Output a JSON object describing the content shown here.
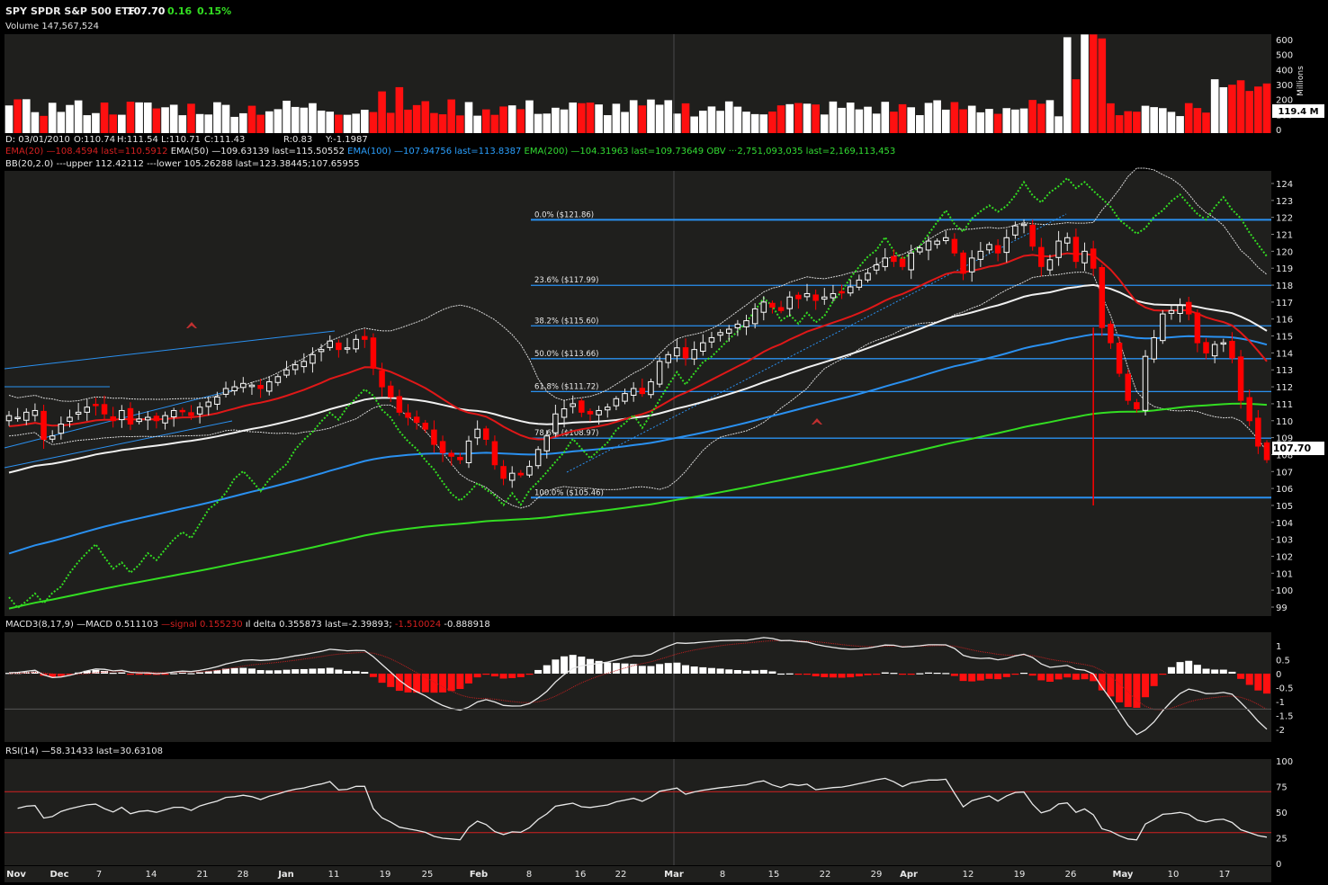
{
  "header": {
    "symbol": "SPY",
    "name": "SPDR S&P 500 ETF",
    "price": "107.70",
    "change": "0.16",
    "change_pct": "0.15%",
    "volume_label": "Volume 147,567,524"
  },
  "info_line": {
    "date": "D: 03/01/2010",
    "open": "O:110.74",
    "high": "H:111.54",
    "low": "L:110.71",
    "close": "C:111.43",
    "r": "R:0.83",
    "y": "Y:-1.1987"
  },
  "legend_line1": [
    {
      "text": "EMA(20) —108.4594 last=110.5912",
      "color": "#d42020"
    },
    {
      "text": "EMA(50) —109.63139 last=115.50552",
      "color": "#e8e8e8"
    },
    {
      "text": "EMA(100) —107.94756 last=113.8387",
      "color": "#2aa0ff"
    },
    {
      "text": "EMA(200) —104.31963 last=109.73649",
      "color": "#33dd33"
    },
    {
      "text": "OBV ···2,751,093,035 last=2,169,113,453",
      "color": "#33dd33"
    }
  ],
  "legend_bb": "BB(20,2.0) ---upper 112.42112 ---lower 105.26288 last=123.38445;107.65955",
  "macd_legend": [
    {
      "text": "MACD3(8,17,9) —MACD 0.511103",
      "color": "#e8e8e8"
    },
    {
      "text": "—signal 0.155230",
      "color": "#d42020"
    },
    {
      "text": "ıl delta 0.355873 last=-2.39893;",
      "color": "#e8e8e8"
    },
    {
      "text": "-1.510024",
      "color": "#d42020"
    },
    {
      "text": "-0.888918",
      "color": "#e8e8e8"
    }
  ],
  "rsi_legend": "RSI(14) —58.31433 last=30.63108",
  "volume_axis": {
    "ticks": [
      "600",
      "500",
      "400",
      "300",
      "200",
      "100",
      "0"
    ],
    "unit": "Millions",
    "last": "119.4 M"
  },
  "last_price_tag": "107.70",
  "colors": {
    "up": "#ffffff",
    "down": "#ff0000",
    "ema20": "#e01818",
    "ema50": "#f0f0f0",
    "ema100": "#2a90f0",
    "ema200": "#33dd22",
    "obv": "#33dd22",
    "fib": "#2a90f0",
    "bg": "#1f1f1d"
  },
  "x_axis": [
    {
      "label": "Nov",
      "bold": true
    },
    {
      "label": "Dec",
      "bold": true
    },
    {
      "label": "7",
      "bold": false
    },
    {
      "label": "14",
      "bold": false
    },
    {
      "label": "21",
      "bold": false
    },
    {
      "label": "28",
      "bold": false
    },
    {
      "label": "Jan",
      "bold": true
    },
    {
      "label": "11",
      "bold": false
    },
    {
      "label": "19",
      "bold": false
    },
    {
      "label": "25",
      "bold": false
    },
    {
      "label": "Feb",
      "bold": true
    },
    {
      "label": "8",
      "bold": false
    },
    {
      "label": "16",
      "bold": false
    },
    {
      "label": "22",
      "bold": false
    },
    {
      "label": "Mar",
      "bold": true
    },
    {
      "label": "8",
      "bold": false
    },
    {
      "label": "15",
      "bold": false
    },
    {
      "label": "22",
      "bold": false
    },
    {
      "label": "29",
      "bold": false
    },
    {
      "label": "Apr",
      "bold": true
    },
    {
      "label": "12",
      "bold": false
    },
    {
      "label": "19",
      "bold": false
    },
    {
      "label": "26",
      "bold": false
    },
    {
      "label": "May",
      "bold": true
    },
    {
      "label": "10",
      "bold": false
    },
    {
      "label": "17",
      "bold": false
    }
  ],
  "chart_data": {
    "type": "candlestick",
    "title": "SPY SPDR S&P 500 ETF",
    "price_axis": {
      "min": 99,
      "max": 124,
      "ticks": [
        99,
        100,
        101,
        102,
        103,
        104,
        105,
        106,
        107,
        108,
        109,
        110,
        111,
        112,
        113,
        114,
        115,
        116,
        117,
        118,
        119,
        120,
        121,
        122,
        123,
        124
      ]
    },
    "fibonacci": [
      {
        "label": "0.0%",
        "price": 121.86,
        "text": "($121.86)"
      },
      {
        "label": "23.6%",
        "price": 117.99,
        "text": "($117.99)"
      },
      {
        "label": "38.2%",
        "price": 115.6,
        "text": "($115.60)"
      },
      {
        "label": "50.0%",
        "price": 113.66,
        "text": "($113.66)"
      },
      {
        "label": "61.8%",
        "price": 111.72,
        "text": "($111.72)"
      },
      {
        "label": "78.6%",
        "price": 108.97,
        "text": "($108.97)"
      },
      {
        "label": "100.0%",
        "price": 105.46,
        "text": "($105.46)"
      }
    ],
    "close": [
      110.3,
      110.2,
      110.5,
      110.6,
      108.9,
      109.1,
      109.8,
      110.2,
      110.5,
      110.8,
      110.9,
      110.4,
      110.0,
      110.6,
      109.8,
      110.1,
      110.2,
      110.0,
      110.3,
      110.6,
      110.6,
      110.3,
      110.8,
      111.1,
      111.4,
      111.9,
      112.0,
      112.2,
      112.1,
      111.9,
      112.3,
      112.6,
      113.0,
      113.3,
      113.5,
      113.9,
      114.2,
      114.7,
      114.2,
      114.3,
      114.8,
      114.8,
      113.1,
      112.0,
      111.4,
      110.5,
      110.2,
      109.9,
      109.5,
      108.6,
      108.1,
      107.9,
      107.7,
      108.8,
      109.5,
      108.9,
      107.4,
      106.6,
      106.9,
      106.8,
      107.3,
      108.3,
      109.1,
      110.4,
      110.7,
      111.0,
      110.5,
      110.4,
      110.6,
      110.8,
      111.3,
      111.6,
      111.9,
      111.6,
      112.3,
      113.5,
      113.9,
      114.3,
      113.7,
      114.2,
      114.6,
      114.9,
      115.2,
      115.4,
      115.7,
      115.9,
      116.6,
      117.0,
      116.7,
      116.5,
      117.3,
      117.2,
      117.5,
      117.1,
      117.3,
      117.5,
      117.6,
      117.9,
      118.3,
      118.7,
      119.2,
      119.6,
      119.4,
      119.1,
      119.9,
      120.2,
      120.6,
      120.6,
      120.8,
      119.9,
      118.7,
      119.6,
      120.0,
      120.4,
      119.9,
      120.8,
      121.5,
      121.6,
      120.3,
      119.1,
      119.5,
      120.6,
      120.8,
      119.4,
      120.0,
      119.0,
      115.5,
      114.6,
      112.8,
      111.2,
      110.7,
      113.8,
      114.9,
      116.3,
      116.5,
      116.8,
      116.3,
      114.6,
      114.0,
      114.5,
      114.6,
      113.7,
      111.2,
      110.0,
      108.5,
      107.7
    ],
    "ema_last": {
      "EMA(20)": 110.5912,
      "EMA(50)": 115.50552,
      "EMA(100)": 113.8387,
      "EMA(200)": 109.73649
    },
    "macd_axis": {
      "ticks": [
        "1",
        "0.5",
        "0",
        "-0.5",
        "-1",
        "-1.5",
        "-2"
      ]
    },
    "rsi_axis": {
      "ticks": [
        "100",
        "75",
        "50",
        "25",
        "0"
      ],
      "levels": [
        70,
        30
      ]
    }
  }
}
